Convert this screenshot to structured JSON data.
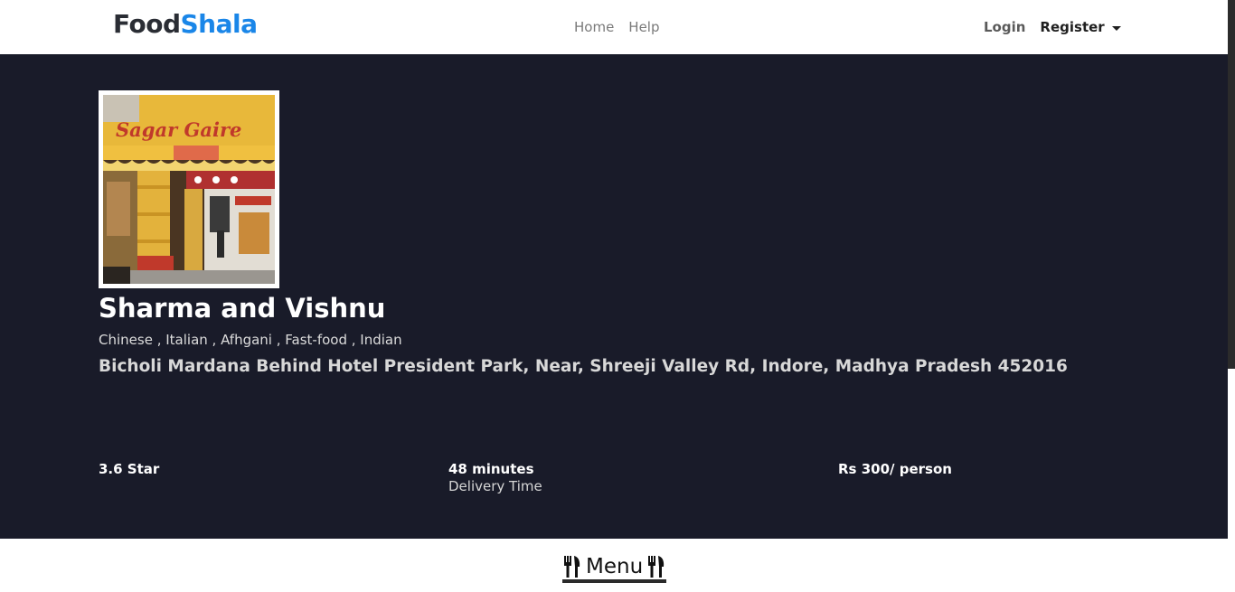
{
  "navbar": {
    "brand_part1": "Food",
    "brand_part2": "Shala",
    "links": [
      "Home",
      "Help"
    ],
    "login": "Login",
    "register": "Register"
  },
  "restaurant": {
    "name": "Sharma and Vishnu",
    "cuisines": "Chinese , Italian , Afhgani , Fast-food , Indian",
    "address": "Bicholi Mardana Behind Hotel President Park, Near, Shreeji Valley Rd, Indore, Madhya Pradesh 452016",
    "photo_sign_text": "Sagar Gaire",
    "rating": "3.6 Star",
    "delivery_time": "48 minutes",
    "delivery_label": "Delivery Time",
    "price": "Rs 300/ person"
  },
  "menu": {
    "title": "Menu"
  },
  "colors": {
    "hero_bg": "#191b29",
    "brand_blue": "#1a86e8",
    "brand_dark": "#2a2d34"
  },
  "icons": {
    "menu_left": "utensils-icon",
    "menu_right": "utensils-icon",
    "register_caret": "caret-down-icon"
  }
}
